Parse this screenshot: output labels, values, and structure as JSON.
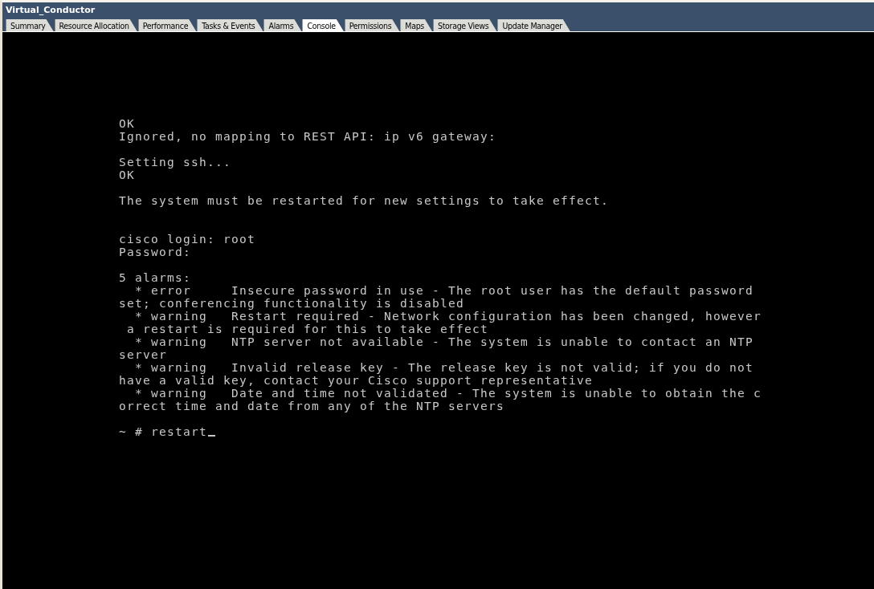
{
  "window": {
    "title": "Virtual_Conductor"
  },
  "tabs": [
    {
      "label": "Summary",
      "selected": false
    },
    {
      "label": "Resource Allocation",
      "selected": false
    },
    {
      "label": "Performance",
      "selected": false
    },
    {
      "label": "Tasks & Events",
      "selected": false
    },
    {
      "label": "Alarms",
      "selected": false
    },
    {
      "label": "Console",
      "selected": true
    },
    {
      "label": "Permissions",
      "selected": false
    },
    {
      "label": "Maps",
      "selected": false
    },
    {
      "label": "Storage Views",
      "selected": false
    },
    {
      "label": "Update Manager",
      "selected": false
    }
  ],
  "console": {
    "blocks": [
      {
        "lines": [
          "OK",
          "Ignored, no mapping to REST API: ip v6 gateway:"
        ]
      },
      {
        "lines": [
          "Setting ssh...",
          "OK"
        ]
      },
      {
        "lines": [
          "The system must be restarted for new settings to take effect."
        ]
      },
      {
        "lines": [
          "cisco login: root",
          "Password:"
        ]
      },
      {
        "lines": [
          "5 alarms:",
          "  * error     Insecure password in use - The root user has the default password",
          "set; conferencing functionality is disabled",
          "  * warning   Restart required - Network configuration has been changed, however",
          " a restart is required for this to take effect",
          "  * warning   NTP server not available - The system is unable to contact an NTP",
          "server",
          "  * warning   Invalid release key - The release key is not valid; if you do not",
          "have a valid key, contact your Cisco support representative",
          "  * warning   Date and time not validated - The system is unable to obtain the c",
          "orrect time and date from any of the NTP servers"
        ]
      },
      {
        "lines": [
          "~ # restart"
        ],
        "cursor": true
      }
    ]
  }
}
